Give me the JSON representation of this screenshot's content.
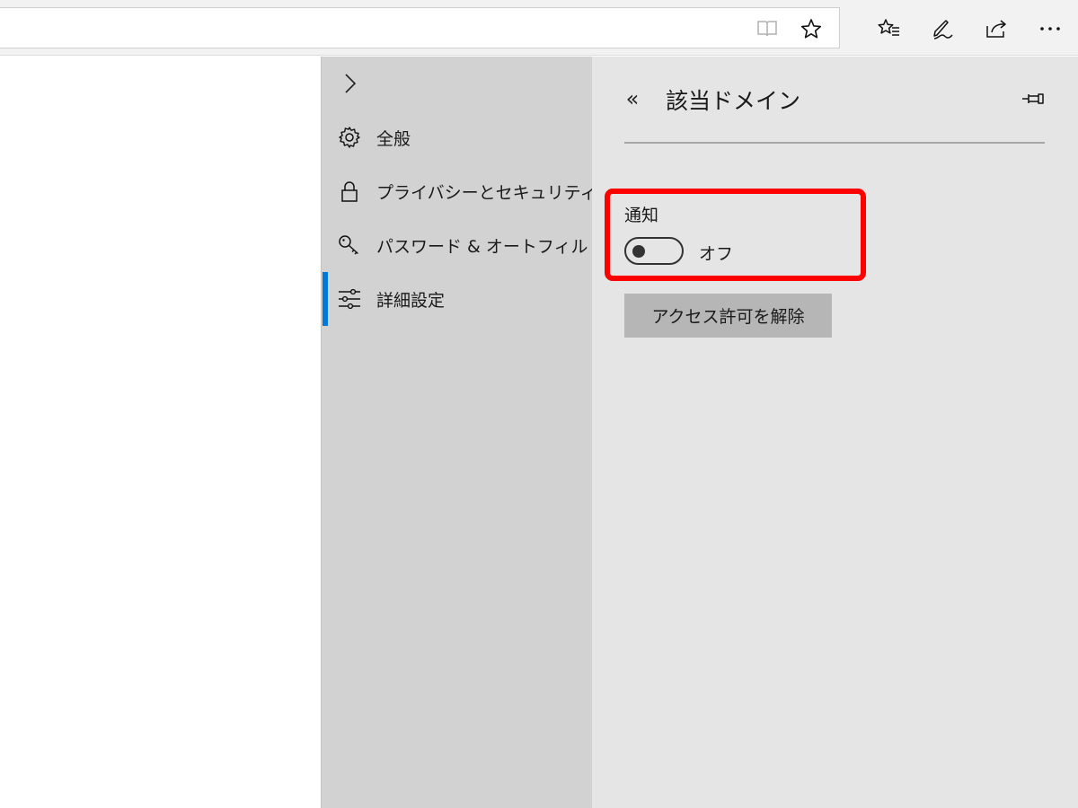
{
  "toolbar": {
    "icons": [
      "reading-view-icon",
      "add-favorite-icon",
      "favorites-hub-icon",
      "web-note-icon",
      "share-icon",
      "more-icon"
    ],
    "more_label": "···"
  },
  "settings_nav": {
    "items": [
      {
        "label": "全般",
        "icon": "gear-icon"
      },
      {
        "label": "プライバシーとセキュリティ",
        "icon": "lock-icon"
      },
      {
        "label": "パスワード & オートフィル",
        "icon": "key-icon"
      },
      {
        "label": "詳細設定",
        "icon": "sliders-icon",
        "active": true
      }
    ]
  },
  "detail": {
    "back_symbol": "«",
    "title": "該当ドメイン",
    "notification_label": "通知",
    "notification_state": "オフ",
    "notification_enabled": false,
    "revoke_button": "アクセス許可を解除"
  },
  "colors": {
    "accent": "#0078d7",
    "highlight": "#ff0000",
    "nav_bg": "#d2d2d2",
    "detail_bg": "#e5e5e5",
    "button_bg": "#b6b6b6"
  }
}
